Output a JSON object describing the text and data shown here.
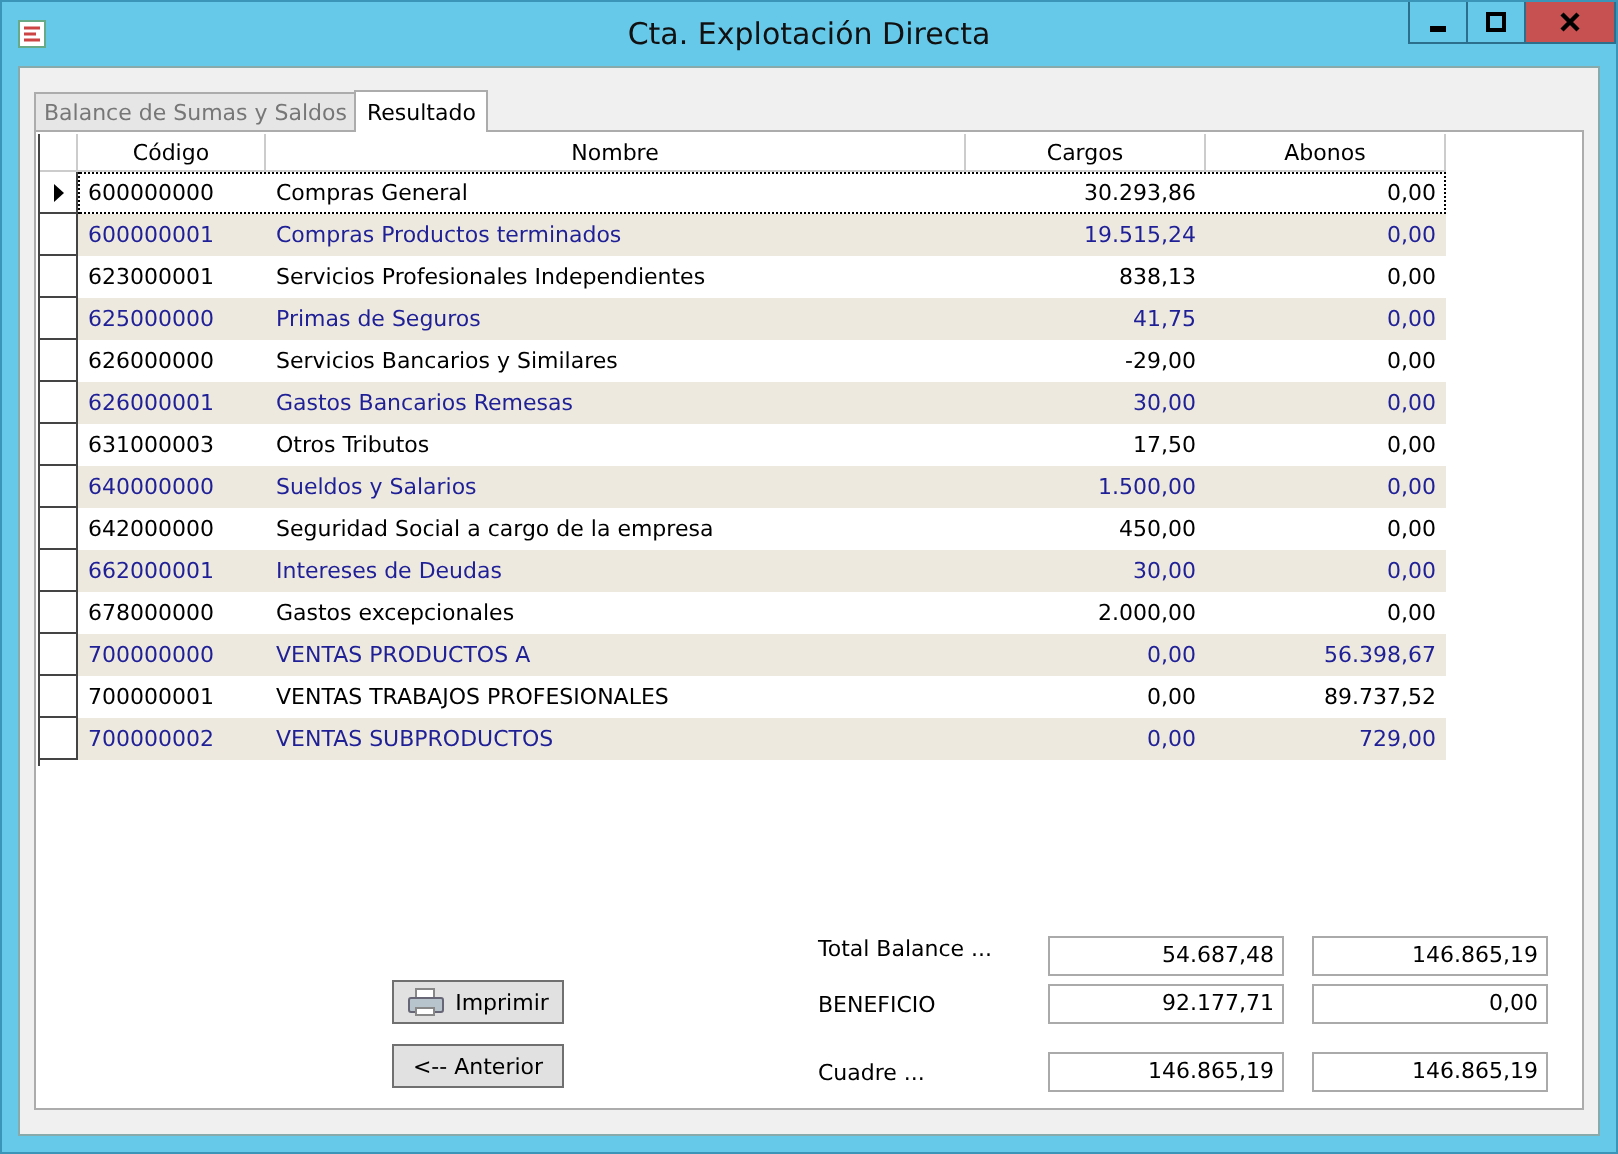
{
  "window": {
    "title": "Cta. Explotación Directa"
  },
  "tabs": [
    {
      "label": "Balance de Sumas y Saldos",
      "selected": false
    },
    {
      "label": "Resultado",
      "selected": true
    }
  ],
  "table": {
    "columns": [
      "Código",
      "Nombre",
      "Cargos",
      "Abonos"
    ],
    "rows": [
      {
        "selected": true,
        "cells": [
          "600000000",
          "Compras General",
          "30.293,86",
          "0,00"
        ]
      },
      {
        "selected": false,
        "cells": [
          "600000001",
          "Compras Productos terminados",
          "19.515,24",
          "0,00"
        ]
      },
      {
        "selected": false,
        "cells": [
          "623000001",
          "Servicios Profesionales Independientes",
          "838,13",
          "0,00"
        ]
      },
      {
        "selected": false,
        "cells": [
          "625000000",
          "Primas de Seguros",
          "41,75",
          "0,00"
        ]
      },
      {
        "selected": false,
        "cells": [
          "626000000",
          "Servicios Bancarios y Similares",
          "-29,00",
          "0,00"
        ]
      },
      {
        "selected": false,
        "cells": [
          "626000001",
          "Gastos Bancarios Remesas",
          "30,00",
          "0,00"
        ]
      },
      {
        "selected": false,
        "cells": [
          "631000003",
          "Otros Tributos",
          "17,50",
          "0,00"
        ]
      },
      {
        "selected": false,
        "cells": [
          "640000000",
          "Sueldos y Salarios",
          "1.500,00",
          "0,00"
        ]
      },
      {
        "selected": false,
        "cells": [
          "642000000",
          "Seguridad Social a cargo de la empresa",
          "450,00",
          "0,00"
        ]
      },
      {
        "selected": false,
        "cells": [
          "662000001",
          "Intereses de Deudas",
          "30,00",
          "0,00"
        ]
      },
      {
        "selected": false,
        "cells": [
          "678000000",
          "Gastos excepcionales",
          "2.000,00",
          "0,00"
        ]
      },
      {
        "selected": false,
        "cells": [
          "700000000",
          "VENTAS PRODUCTOS A",
          "0,00",
          "56.398,67"
        ]
      },
      {
        "selected": false,
        "cells": [
          "700000001",
          "VENTAS TRABAJOS PROFESIONALES",
          "0,00",
          "89.737,52"
        ]
      },
      {
        "selected": false,
        "cells": [
          "700000002",
          "VENTAS SUBPRODUCTOS",
          "0,00",
          "729,00"
        ]
      }
    ]
  },
  "buttons": [
    {
      "kind": "print",
      "label": "Imprimir"
    },
    {
      "kind": "plain",
      "label": "<-- Anterior"
    }
  ],
  "totals": [
    {
      "label": "Total Balance ...",
      "values": [
        "54.687,48",
        "146.865,19"
      ]
    },
    {
      "label": "BENEFICIO",
      "values": [
        "92.177,71",
        "0,00"
      ]
    },
    {
      "label": "Cuadre ...",
      "values": [
        "146.865,19",
        "146.865,19"
      ]
    }
  ]
}
